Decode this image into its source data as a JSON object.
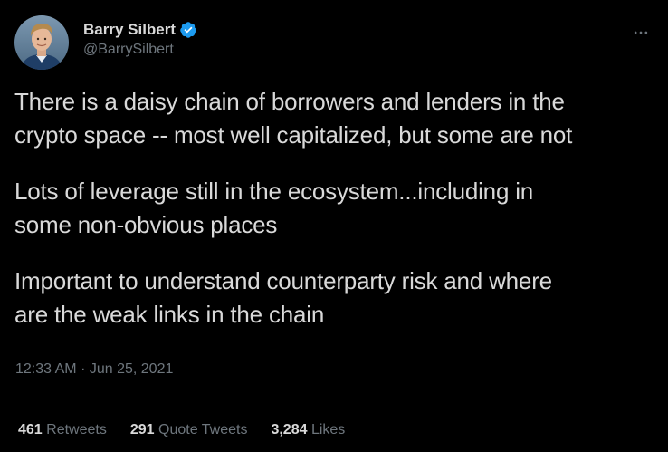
{
  "author": {
    "display_name": "Barry Silbert",
    "handle": "@BarrySilbert",
    "verified": true,
    "verified_color": "#1d9bf0"
  },
  "more_icon": "more-horizontal-icon",
  "tweet": {
    "paragraphs": [
      {
        "lines": [
          "There is a daisy chain of borrowers and lenders in the",
          "crypto space -- most well capitalized, but some are not"
        ]
      },
      {
        "lines": [
          "Lots of leverage still in the ecosystem...including in",
          "some non-obvious places"
        ]
      },
      {
        "lines": [
          "Important to understand counterparty risk and where",
          "are the weak links in the chain"
        ]
      }
    ]
  },
  "meta": {
    "time": "12:33 AM",
    "separator": "·",
    "date": "Jun 25, 2021"
  },
  "stats": {
    "retweets": {
      "count": "461",
      "label": "Retweets"
    },
    "quote_tweets": {
      "count": "291",
      "label": "Quote Tweets"
    },
    "likes": {
      "count": "3,284",
      "label": "Likes"
    }
  },
  "colors": {
    "background": "#000000",
    "text_primary": "#d9d9d9",
    "text_secondary": "#6e767d",
    "divider": "#2f3336"
  }
}
